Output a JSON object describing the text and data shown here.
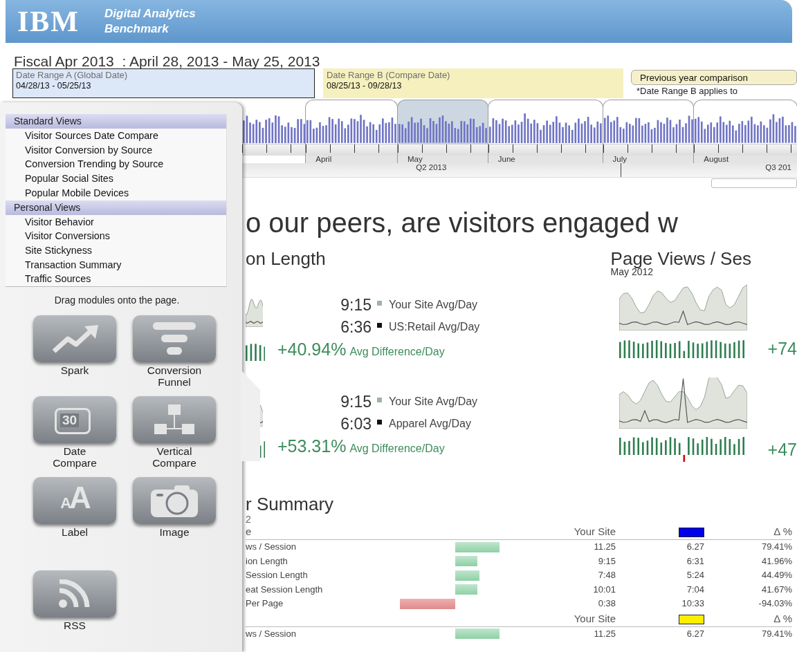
{
  "header": {
    "logo": "IBM",
    "title_lines": [
      "Digital Analytics",
      "Benchmark"
    ]
  },
  "period_title": "Fiscal Apr 2013  : April 28, 2013 - May 25, 2013",
  "date_ranges": [
    {
      "kind": "global",
      "label": "Date Range A (Global Date)",
      "value": "04/28/13 - 05/25/13"
    },
    {
      "kind": "compare",
      "label": "Date Range B (Compare Date)",
      "value": "08/25/13 - 09/28/13"
    }
  ],
  "comparison": {
    "button": "Previous year comparison",
    "note": "*Date Range B applies to"
  },
  "timeline": {
    "months": [
      {
        "label": "April",
        "selected": false
      },
      {
        "label": "May",
        "selected": true
      },
      {
        "label": "June",
        "selected": false
      },
      {
        "label": "July",
        "selected": false
      },
      {
        "label": "August",
        "selected": false
      }
    ],
    "quarters": [
      "Q2 2013",
      "Q3 201"
    ]
  },
  "module_panel": {
    "sections": [
      {
        "title": "Standard Views",
        "items": [
          "Visitor Sources Date Compare",
          "Visitor Conversion by Source",
          "Conversion Trending by Source",
          "Popular Social Sites",
          "Popular Mobile Devices"
        ]
      },
      {
        "title": "Personal Views",
        "items": [
          "Visitor Behavior",
          "Visitor Conversions",
          "Site Stickyness",
          "Transaction Summary",
          "Traffic Sources"
        ]
      }
    ],
    "hint": "Drag modules onto the page.",
    "modules": [
      {
        "kind": "spark",
        "label": "Spark"
      },
      {
        "kind": "funnel",
        "label": "Conversion\nFunnel"
      },
      {
        "kind": "calendar",
        "label": "Date\nCompare",
        "icon_text": "30"
      },
      {
        "kind": "hierarchy",
        "label": "Vertical\nCompare"
      },
      {
        "kind": "text",
        "label": "Label",
        "icon_text": "AA"
      },
      {
        "kind": "camera",
        "label": "Image"
      },
      {
        "kind": "rss",
        "label": "RSS"
      }
    ]
  },
  "headline": "o our peers, are visitors engaged w",
  "metrics": {
    "left": {
      "title": "on Length",
      "blocks": [
        {
          "rows": [
            {
              "value": "9:15",
              "label": "Your Site Avg/Day",
              "color": "#9db59d"
            },
            {
              "value": "6:36",
              "label": "US:Retail Avg/Day",
              "color": "#111111"
            }
          ],
          "difference": "+40.94%",
          "difference_label": "Avg Difference/Day"
        },
        {
          "rows": [
            {
              "value": "9:15",
              "label": "Your Site Avg/Day",
              "color": "#9db59d"
            },
            {
              "value": "6:03",
              "label": "Apparel Avg/Day",
              "color": "#111111"
            }
          ],
          "difference": "+53.31%",
          "difference_label": "Avg Difference/Day"
        }
      ]
    },
    "right": {
      "title": "Page Views / Ses",
      "subtitle": "May 2012",
      "blocks": [
        {
          "difference": "+74"
        },
        {
          "difference": "+47"
        }
      ]
    }
  },
  "summary": {
    "title": "r Summary",
    "subtitle": "2",
    "column_label": "e",
    "groups": [
      {
        "header": {
          "value_label": "Your Site",
          "color": "#0000ee",
          "delta_label": "Δ %"
        },
        "rows": [
          {
            "label": "ws / Session",
            "kind": "positive",
            "value": "11.25",
            "compare": "6.27",
            "delta": "79.41%"
          },
          {
            "label": "ion Length",
            "kind": "positive",
            "value": "9:15",
            "compare": "6:31",
            "delta": "41.96%"
          },
          {
            "label": "Session Length",
            "kind": "positive",
            "value": "7:48",
            "compare": "5:24",
            "delta": "44.49%"
          },
          {
            "label": "eat Session Length",
            "kind": "positive",
            "value": "10:01",
            "compare": "7:04",
            "delta": "41.67%"
          },
          {
            "label": "Per Page",
            "kind": "negative",
            "value": "0:38",
            "compare": "10:33",
            "delta": "-94.03%"
          }
        ]
      },
      {
        "header": {
          "value_label": "Your Site",
          "color": "#ffee00",
          "delta_label": "Δ %"
        },
        "rows": [
          {
            "label": "ws / Session",
            "kind": "positive",
            "value": "11.25",
            "compare": "6.27",
            "delta": "79.41%"
          }
        ]
      }
    ]
  }
}
